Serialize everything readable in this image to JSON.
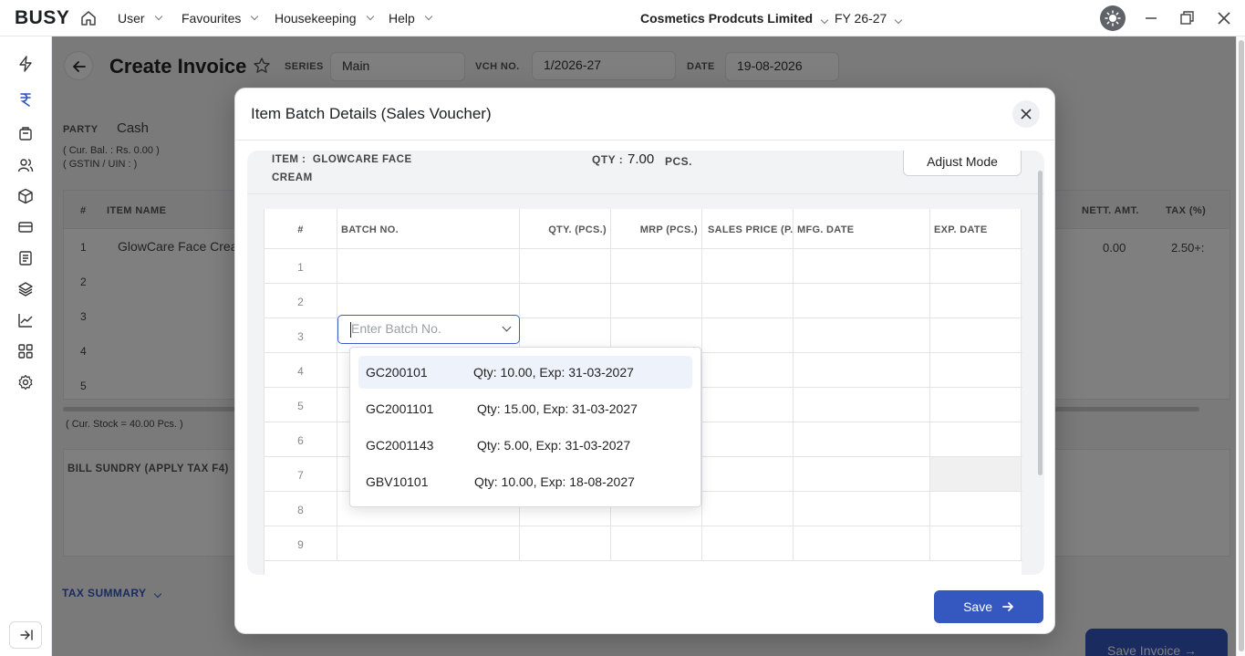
{
  "topbar": {
    "logo": "BUSY",
    "menus": [
      "User",
      "Favourites",
      "Housekeeping",
      "Help"
    ],
    "company": "Cosmetics Prodcuts Limited",
    "fy": "FY 26-27"
  },
  "background": {
    "title": "Create Invoice",
    "series_label": "SERIES",
    "series_value": "Main",
    "vch_label": "VCH NO.",
    "vch_value": "1/2026-27",
    "date_label": "DATE",
    "date_value": "19-08-2026",
    "party_label": "PARTY",
    "party_value": "Cash",
    "cur_bal": "( Cur. Bal. : Rs. 0.00    )",
    "gstin": "( GSTIN / UIN : )",
    "columns": [
      "#",
      "ITEM NAME",
      "NETT. AMT.",
      "TAX (%)"
    ],
    "row1_name": "GlowCare Face Cream",
    "row1_amt": "0.00",
    "row1_tax": "2.50+:",
    "row_nums": [
      "1",
      "2",
      "3",
      "4",
      "5"
    ],
    "cur_stock": "( Cur. Stock = 40.00  Pcs. )",
    "bill_sundry": "BILL SUNDRY (APPLY TAX F4)",
    "tax_summary": "TAX SUMMARY",
    "save_invoice": "Save Invoice"
  },
  "modal": {
    "title": "Item Batch Details (Sales Voucher)",
    "item_label": "ITEM :",
    "item_name_line1": "GLOWCARE FACE",
    "item_name_line2": "CREAM",
    "qty_label": "QTY :",
    "qty_value": "7.00",
    "qty_unit": "PCS.",
    "adjust_mode": "Adjust Mode",
    "columns": [
      "#",
      "BATCH NO.",
      "QTY. (PCS.)",
      "MRP (PCS.)",
      "SALES PRICE (P...",
      "MFG. DATE",
      "EXP. DATE"
    ],
    "row_nums": [
      "1",
      "2",
      "3",
      "4",
      "5",
      "6",
      "7",
      "8",
      "9"
    ],
    "batch_placeholder": "Enter Batch No.",
    "options": [
      {
        "code": "GC200101",
        "info": "Qty: 10.00, Exp: 31-03-2027"
      },
      {
        "code": "GC2001101",
        "info": "Qty: 15.00, Exp: 31-03-2027"
      },
      {
        "code": "GC2001143",
        "info": "Qty: 5.00, Exp: 31-03-2027"
      },
      {
        "code": "GBV10101",
        "info": "Qty: 10.00, Exp: 18-08-2027"
      }
    ],
    "save": "Save"
  }
}
